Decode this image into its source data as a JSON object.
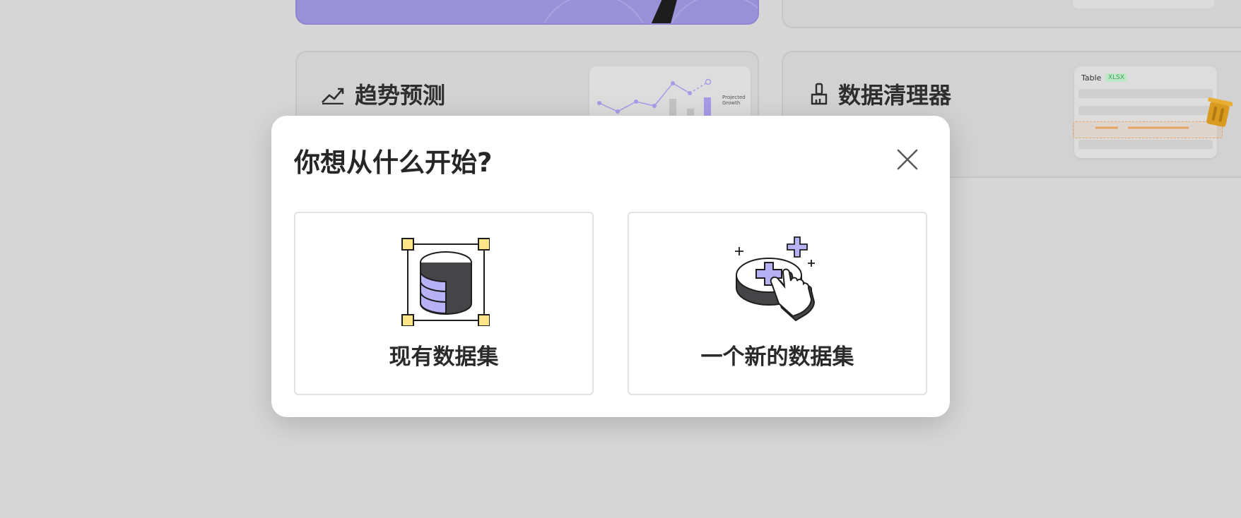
{
  "background_cards": {
    "trend": {
      "title": "趋势预测",
      "thumb_label_line1": "Projected",
      "thumb_label_line2": "Growth"
    },
    "cleaner": {
      "title": "数据清理器",
      "thumb_title": "Table",
      "thumb_badge": "XLSX"
    }
  },
  "modal": {
    "title": "你想从什么开始?",
    "options": [
      {
        "label": "现有数据集",
        "icon": "database-selection-icon"
      },
      {
        "label": "一个新的数据集",
        "icon": "add-dataset-hand-icon"
      }
    ]
  },
  "colors": {
    "accent_purple": "#a79be8",
    "icon_purple": "#b7b2f5",
    "handle_yellow": "#fde58a",
    "cleaner_orange": "#e9a262",
    "trash_gold": "#d99a20"
  }
}
